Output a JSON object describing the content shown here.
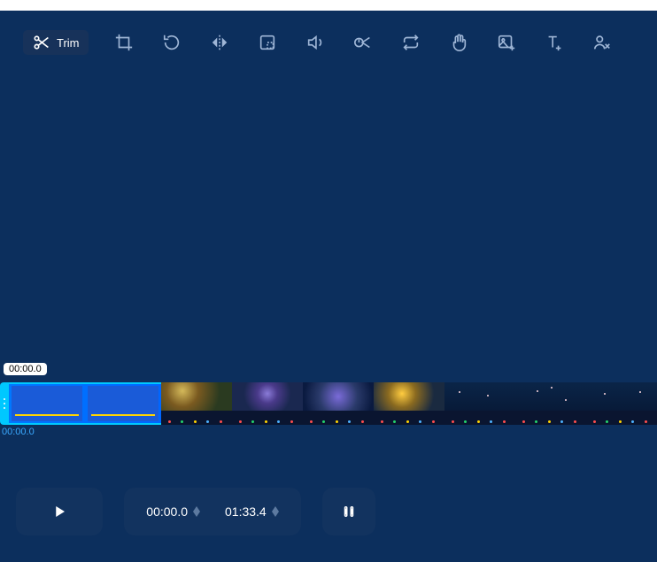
{
  "toolbar": {
    "trim_label": "Trim"
  },
  "timeline": {
    "playhead_label": "00:00.0",
    "under_time": "00:00.0"
  },
  "controls": {
    "start_time": "00:00.0",
    "end_time": "01:33.4"
  }
}
